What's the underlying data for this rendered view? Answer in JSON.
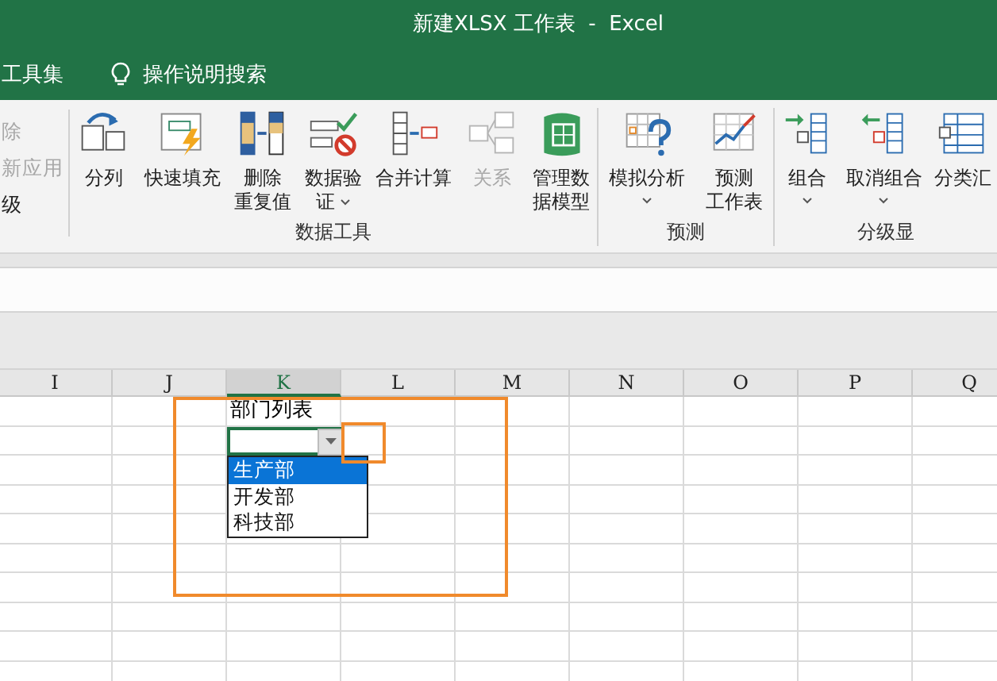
{
  "window": {
    "title": "新建XLSX 工作表  -  Excel"
  },
  "tabs": [
    {
      "label": "工具集"
    }
  ],
  "search": {
    "label": "操作说明搜索"
  },
  "ribbon": {
    "partial_items": [
      {
        "label": "除",
        "disabled": true
      },
      {
        "label": "新应用",
        "disabled": true
      },
      {
        "label": "级",
        "disabled": false
      }
    ],
    "groups": [
      {
        "label": "数据工具",
        "buttons": [
          {
            "kind": "split",
            "lines": [
              "分列"
            ],
            "dropdown": false,
            "disabled": false
          },
          {
            "kind": "flashfill",
            "lines": [
              "快速填充"
            ],
            "dropdown": false,
            "disabled": false
          },
          {
            "kind": "dedupe",
            "lines": [
              "删除",
              "重复值"
            ],
            "dropdown": false,
            "disabled": false
          },
          {
            "kind": "validate",
            "lines": [
              "数据验",
              "证"
            ],
            "dropdown": true,
            "disabled": false
          },
          {
            "kind": "consolidate",
            "lines": [
              "合并计算"
            ],
            "dropdown": false,
            "disabled": false
          },
          {
            "kind": "relations",
            "lines": [
              "关系"
            ],
            "dropdown": false,
            "disabled": true
          },
          {
            "kind": "model",
            "lines": [
              "管理数",
              "据模型"
            ],
            "dropdown": false,
            "disabled": false
          }
        ]
      },
      {
        "label": "预测",
        "buttons": [
          {
            "kind": "whatif",
            "lines": [
              "模拟分析"
            ],
            "dropdown": true,
            "disabled": false
          },
          {
            "kind": "forecast",
            "lines": [
              "预测",
              "工作表"
            ],
            "dropdown": false,
            "disabled": false
          }
        ]
      },
      {
        "label": "分级显",
        "buttons": [
          {
            "kind": "group",
            "lines": [
              "组合"
            ],
            "dropdown": true,
            "disabled": false
          },
          {
            "kind": "ungroup",
            "lines": [
              "取消组合"
            ],
            "dropdown": true,
            "disabled": false
          },
          {
            "kind": "subtotal",
            "lines": [
              "分类汇"
            ],
            "dropdown": false,
            "disabled": false
          }
        ]
      }
    ]
  },
  "sheet": {
    "columns": [
      {
        "label": "I",
        "selected": false
      },
      {
        "label": "J",
        "selected": false
      },
      {
        "label": "K",
        "selected": true
      },
      {
        "label": "L",
        "selected": false
      },
      {
        "label": "M",
        "selected": false
      },
      {
        "label": "N",
        "selected": false
      },
      {
        "label": "O",
        "selected": false
      },
      {
        "label": "P",
        "selected": false
      },
      {
        "label": "Q",
        "selected": false
      }
    ],
    "list_title": {
      "text": "部门列表"
    },
    "dropdown": {
      "items": [
        {
          "label": "生产部",
          "selected": true
        },
        {
          "label": "开发部",
          "selected": false
        },
        {
          "label": "科技部",
          "selected": false
        }
      ]
    }
  }
}
